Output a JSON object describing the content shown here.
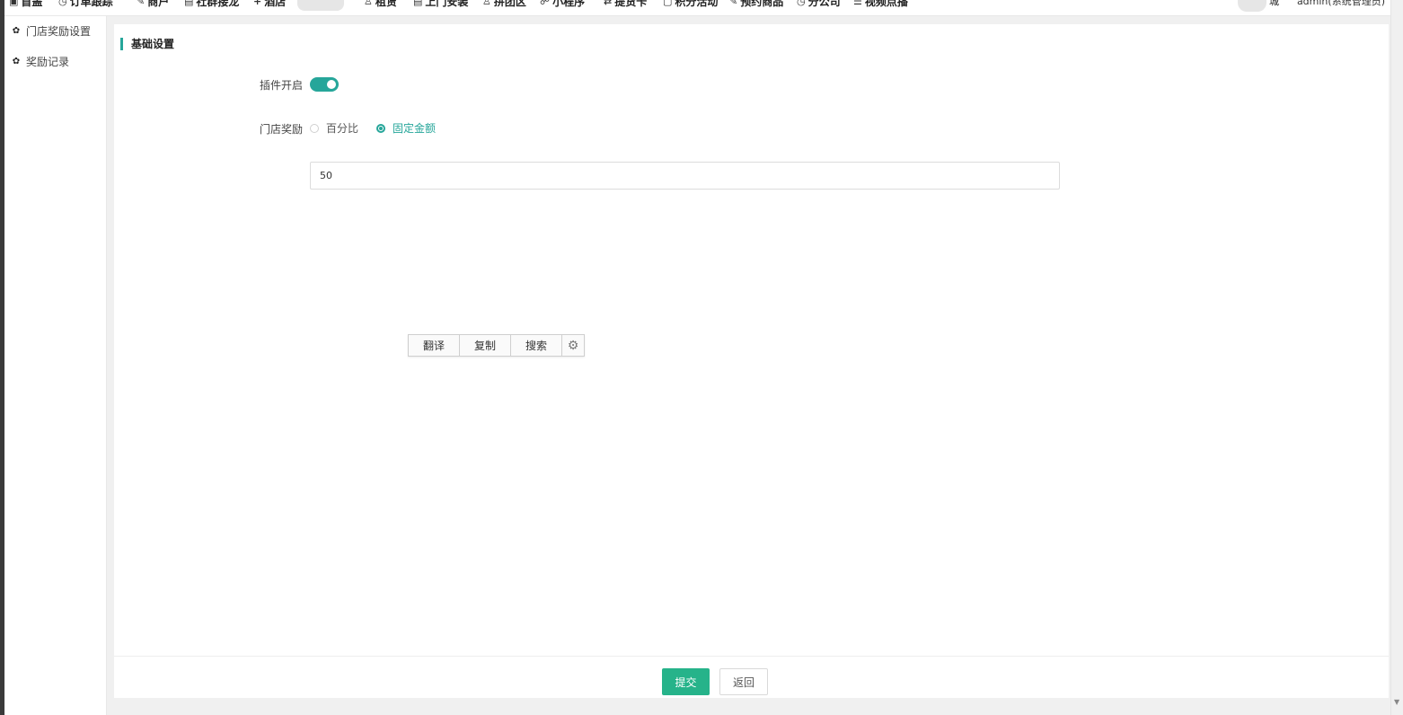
{
  "topnav": {
    "items": [
      {
        "icon": "home-icon",
        "glyph": "▣",
        "label": "首盖"
      },
      {
        "icon": "clock-icon",
        "glyph": "◷",
        "label": "订单跟踪"
      },
      {
        "icon": "wrench-icon",
        "glyph": "✎",
        "label": "商户"
      },
      {
        "icon": "chart-icon",
        "glyph": "▤",
        "label": "社群接龙"
      },
      {
        "icon": "plus-icon",
        "glyph": "+",
        "label": "酒店"
      },
      {
        "icon": "user-icon",
        "glyph": "♙",
        "label": "租赁"
      },
      {
        "icon": "chart-icon",
        "glyph": "▤",
        "label": "上门安装"
      },
      {
        "icon": "user-icon",
        "glyph": "♙",
        "label": "拼团区"
      },
      {
        "icon": "link-icon",
        "glyph": "☍",
        "label": "小程序"
      },
      {
        "icon": "exchange-icon",
        "glyph": "⇄",
        "label": "提货卡"
      },
      {
        "icon": "doc-icon",
        "glyph": "▢",
        "label": "积分活动"
      },
      {
        "icon": "wrench-icon",
        "glyph": "✎",
        "label": "预约商品"
      },
      {
        "icon": "clock-icon",
        "glyph": "◷",
        "label": "分公司"
      },
      {
        "icon": "menu-icon",
        "glyph": "☰",
        "label": "视频点播"
      }
    ],
    "right_text": "城",
    "user": "admin(系统管理员)"
  },
  "sidebar": {
    "items": [
      {
        "icon": "gear-icon",
        "label": "门店奖励设置"
      },
      {
        "icon": "gear-icon",
        "label": "奖励记录"
      }
    ]
  },
  "main": {
    "section_title": "基础设置",
    "plugin_label": "插件开启",
    "plugin_enabled": true,
    "reward_label": "门店奖励",
    "reward_options": [
      {
        "label": "百分比",
        "checked": false
      },
      {
        "label": "固定金额",
        "checked": true
      }
    ],
    "amount_value": "50"
  },
  "popup": {
    "buttons": [
      "翻译",
      "复制",
      "搜索"
    ],
    "settings_icon": "gear-icon"
  },
  "footer": {
    "submit_label": "提交",
    "back_label": "返回"
  },
  "colors": {
    "accent": "#26a69a",
    "submit": "#26b38a"
  }
}
